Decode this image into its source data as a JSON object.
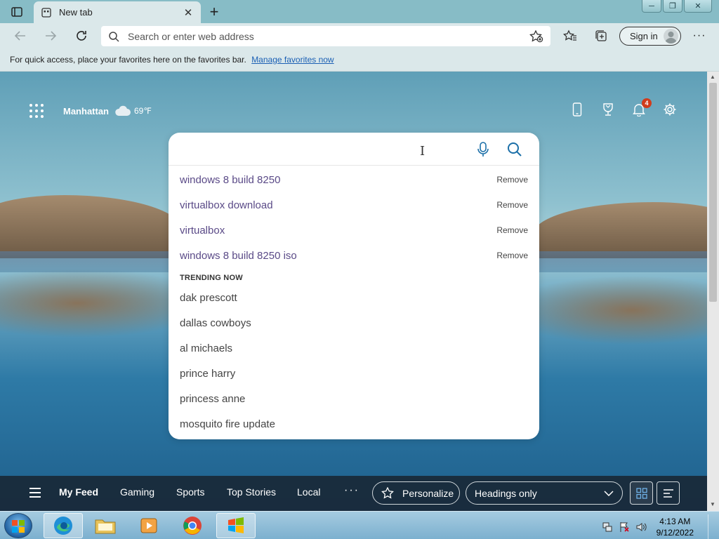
{
  "browser": {
    "tab": {
      "title": "New tab"
    },
    "window_controls": [
      "─",
      "❐",
      "✕"
    ],
    "address_bar": {
      "placeholder": "Search or enter web address"
    },
    "signin_label": "Sign in",
    "more_label": "···",
    "favorites_bar": {
      "message": "For quick access, place your favorites here on the favorites bar.",
      "link": "Manage favorites now"
    }
  },
  "newtab": {
    "location": "Manhattan",
    "temperature": "69℉",
    "notification_count": "4",
    "search": {
      "recent": [
        {
          "query": "windows 8 build 8250",
          "action": "Remove"
        },
        {
          "query": "virtualbox download",
          "action": "Remove"
        },
        {
          "query": "virtualbox",
          "action": "Remove"
        },
        {
          "query": "windows 8 build 8250 iso",
          "action": "Remove"
        }
      ],
      "trending_heading": "TRENDING NOW",
      "trending": [
        "dak prescott",
        "dallas cowboys",
        "al michaels",
        "prince harry",
        "princess anne",
        "mosquito fire update"
      ]
    },
    "feed_nav": {
      "items": [
        "My Feed",
        "Gaming",
        "Sports",
        "Top Stories",
        "Local"
      ],
      "more": "···",
      "personalize": "Personalize",
      "layout_select": "Headings only"
    }
  },
  "taskbar": {
    "clock_time": "4:13 AM",
    "clock_date": "9/12/2022"
  },
  "colors": {
    "accent": "#1a5fb4",
    "suggestion_text": "#5a4a87",
    "feedbar_bg": "#192837",
    "badge": "#d13c1c"
  }
}
